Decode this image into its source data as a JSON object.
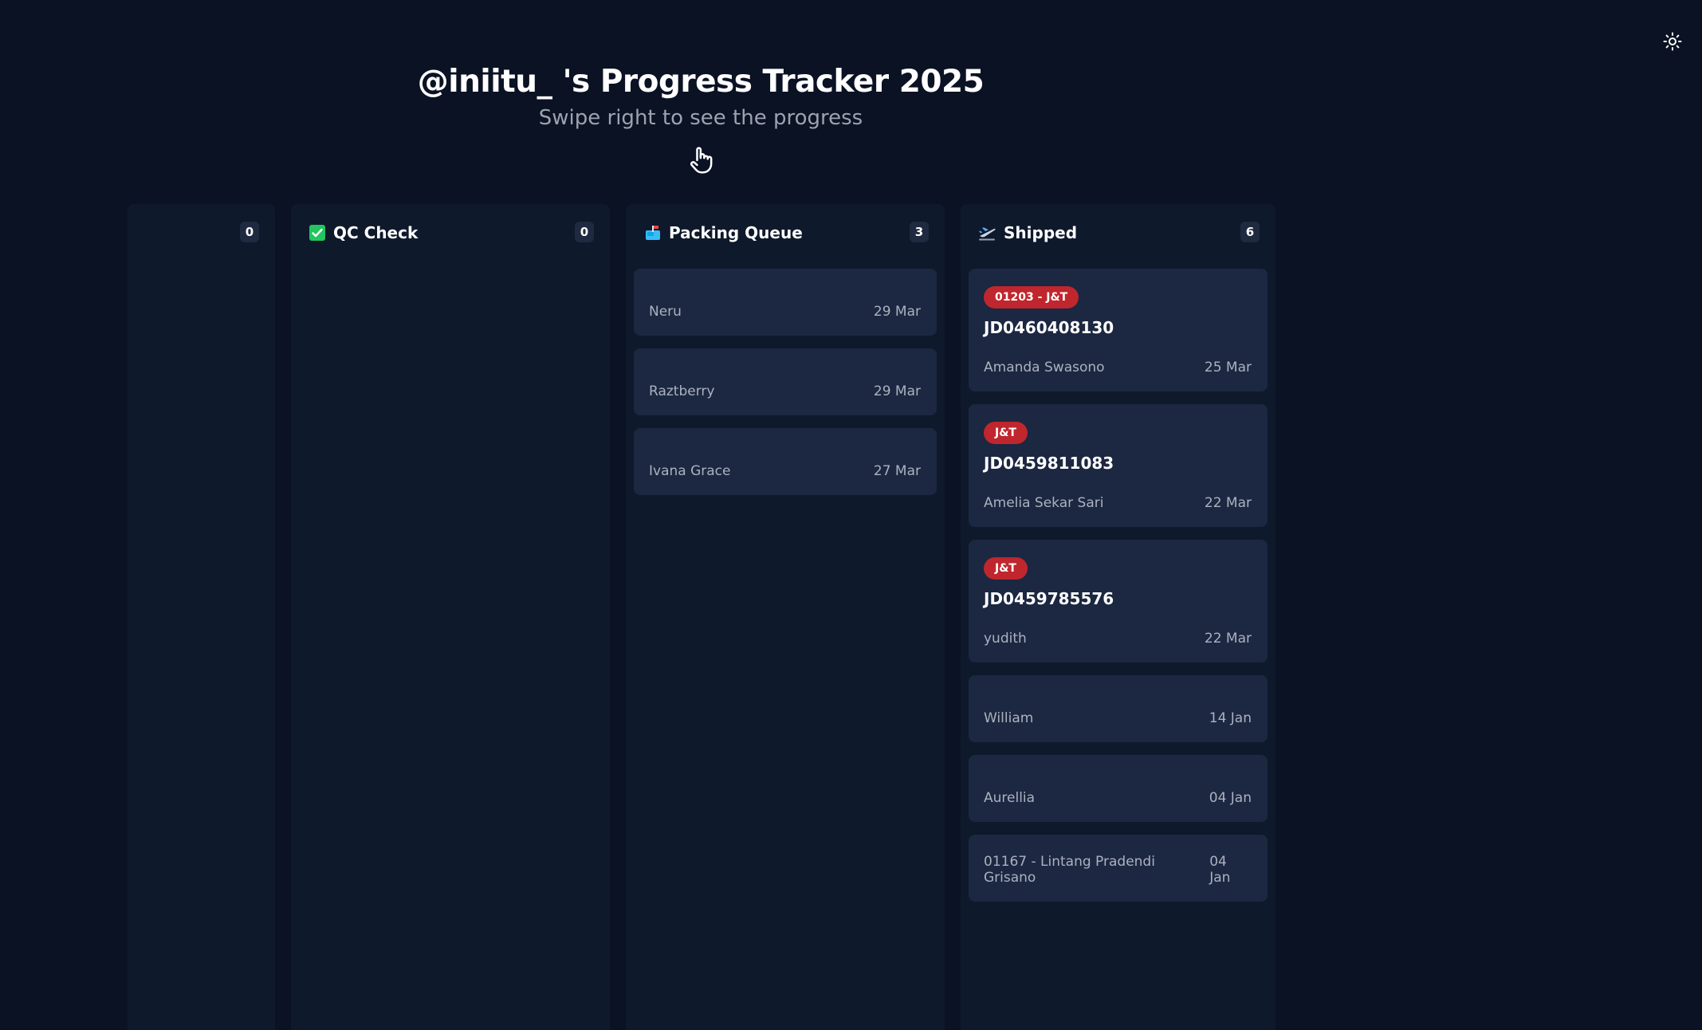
{
  "header": {
    "title": "@iniitu_ 's Progress Tracker 2025",
    "subtitle": "Swipe right to see the progress"
  },
  "icons": {
    "theme_toggle": "sun-icon",
    "swipe_hint": "hand-pointer-icon"
  },
  "colors": {
    "background": "#0b1224",
    "column": "#0f192c",
    "card": "#1c2741",
    "tag": "#c0262d",
    "qc_icon": "#22c55e"
  },
  "columns": [
    {
      "title": "",
      "count": "0",
      "cards": []
    },
    {
      "title": "QC Check",
      "icon": "check-box-icon",
      "count": "0",
      "cards": []
    },
    {
      "title": "Packing Queue",
      "icon": "mailbox-icon",
      "count": "3",
      "cards": [
        {
          "name": "Neru",
          "date": "29 Mar"
        },
        {
          "name": "Raztberry",
          "date": "29 Mar"
        },
        {
          "name": "Ivana Grace",
          "date": "27 Mar"
        }
      ]
    },
    {
      "title": "Shipped",
      "icon": "airplane-departure-icon",
      "count": "6",
      "cards": [
        {
          "tag": "01203 - J&T",
          "tracking": "JD0460408130",
          "name": "Amanda Swasono",
          "date": "25 Mar"
        },
        {
          "tag": "J&T",
          "tracking": "JD0459811083",
          "name": "Amelia Sekar Sari",
          "date": "22 Mar"
        },
        {
          "tag": "J&T",
          "tracking": "JD0459785576",
          "name": "yudith",
          "date": "22 Mar"
        },
        {
          "name": "William",
          "date": "14 Jan"
        },
        {
          "name": "Aurellia",
          "date": "04 Jan"
        },
        {
          "name": "01167 - Lintang Pradendi Grisano",
          "date": "04 Jan"
        }
      ]
    }
  ]
}
